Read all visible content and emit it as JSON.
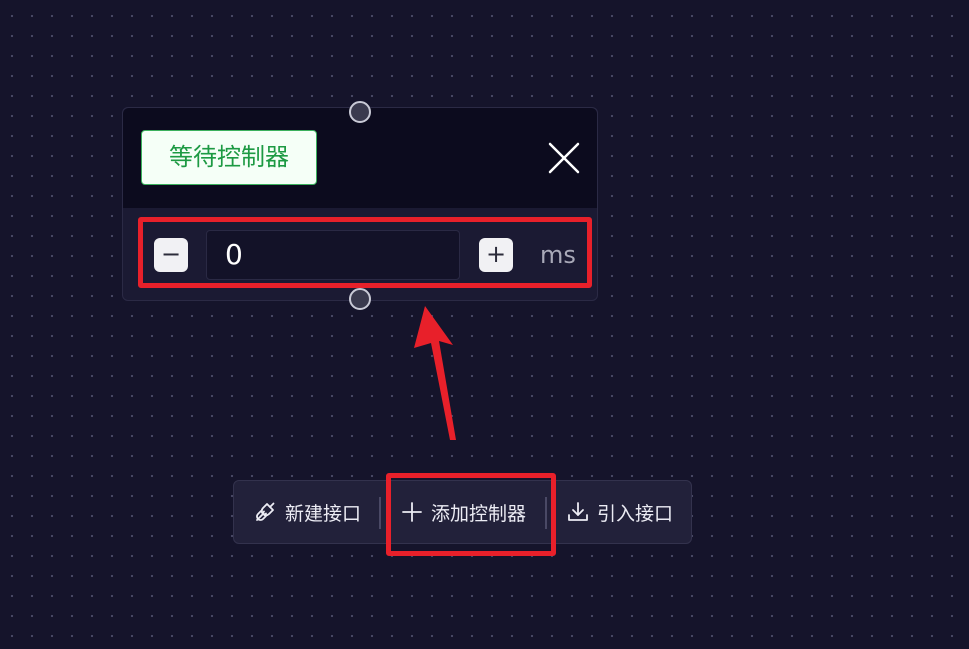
{
  "node": {
    "tag_label": "等待控制器",
    "value": "0",
    "unit": "ms",
    "minus_symbol": "−",
    "plus_symbol": "+"
  },
  "toolbar": {
    "new_interface_label": "新建接口",
    "add_controller_label": "添加控制器",
    "import_interface_label": "引入接口"
  },
  "icons": {
    "close": "close-icon",
    "plug": "plug-icon",
    "plus": "plus-icon",
    "download": "download-icon"
  },
  "colors": {
    "canvas_bg": "#15142b",
    "tag_green": "#1d9a43",
    "annotation_red": "#e8202a"
  }
}
